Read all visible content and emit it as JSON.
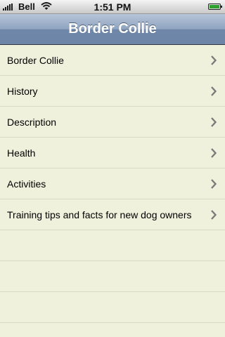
{
  "status_bar": {
    "carrier": "Bell",
    "time": "1:51 PM",
    "signal_icon": "signal-bars-icon",
    "wifi_icon": "wifi-icon",
    "battery_icon": "battery-icon",
    "battery_level": 1.0
  },
  "nav_bar": {
    "title": "Border Collie"
  },
  "menu": {
    "items": [
      {
        "label": "Border Collie"
      },
      {
        "label": "History"
      },
      {
        "label": "Description"
      },
      {
        "label": "Health"
      },
      {
        "label": "Activities"
      },
      {
        "label": "Training tips and facts for new dog owners"
      }
    ],
    "chevron_icon": "chevron-right-icon"
  },
  "colors": {
    "table_background": "#f0f1dc",
    "separator": "#d8d9c6",
    "nav_bar": "#8fa4c0",
    "chevron": "#7a7a7a",
    "battery": "#2ea12e"
  }
}
